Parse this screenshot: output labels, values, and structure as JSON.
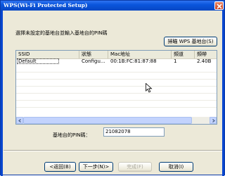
{
  "window": {
    "title": "WPS(Wi-Fi Protected Setup)"
  },
  "prompt": "選擇未設定的基地台並輸入基地台的PIN碼",
  "scan_button": "掃瞄 WPS 基地台(S)",
  "list": {
    "columns": [
      "SSID",
      "狀態",
      "Mac地址",
      "頻道",
      "頻帶"
    ],
    "rows": [
      [
        "Default",
        "Configu...",
        "00:1B:FC:81:87:88",
        "1",
        "2.40B"
      ]
    ]
  },
  "pin": {
    "label": "基地台的PIN碼：",
    "value": "21082078"
  },
  "buttons": {
    "back": "<返回(B)",
    "next": "下一步(N)>",
    "finish": "完成(F)",
    "cancel": "取消(I)"
  },
  "colors": {
    "titlebar": "#0a55dc",
    "close": "#cc3c1a",
    "face": "#ece9d8",
    "border": "#7f9db9"
  }
}
